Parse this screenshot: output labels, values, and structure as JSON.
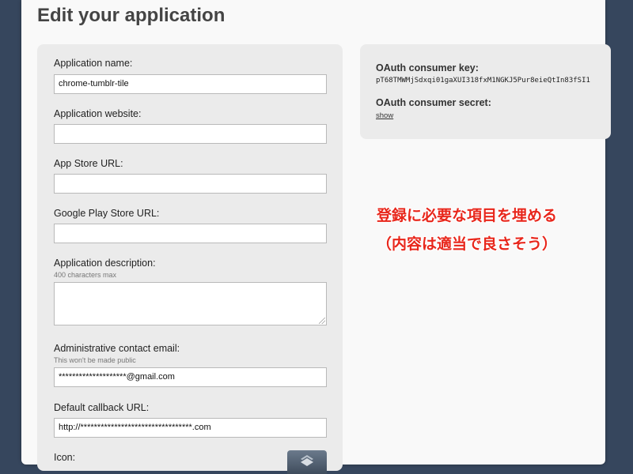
{
  "page": {
    "title": "Edit your application"
  },
  "form": {
    "app_name_label": "Application name:",
    "app_name_value": "chrome-tumblr-tile",
    "website_label": "Application website:",
    "website_value": "",
    "appstore_label": "App Store URL:",
    "appstore_value": "",
    "googleplay_label": "Google Play Store URL:",
    "googleplay_value": "",
    "description_label": "Application description:",
    "description_hint": "400 characters max",
    "description_value": "",
    "email_label": "Administrative contact email:",
    "email_hint": "This won't be made public",
    "email_value": "********************@gmail.com",
    "callback_label": "Default callback URL:",
    "callback_value": "http://*********************************.com",
    "icon_label": "Icon:"
  },
  "oauth": {
    "key_label": "OAuth consumer key:",
    "key_value": "pT68TMWMjSdxqi01gaXUI318fxM1NGKJ5Pur8eieQtIn83fSI1",
    "secret_label": "OAuth consumer secret:",
    "secret_link": "show"
  },
  "annotation": {
    "line1": "登録に必要な項目を埋める",
    "line2": "（内容は適当で良さそう）"
  },
  "icons": {
    "upload": "stack-icon"
  }
}
